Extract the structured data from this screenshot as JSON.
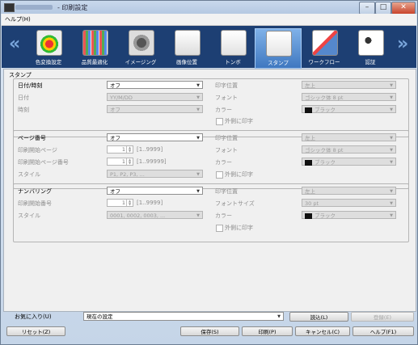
{
  "window": {
    "title": "- 印刷設定",
    "min": "–",
    "max": "□",
    "close": "✕"
  },
  "menu": {
    "help": "ヘルプ(H)"
  },
  "toolbar": {
    "prev": "«",
    "next": "»",
    "items": [
      {
        "label": "色変換設定",
        "icon": "color-conversion-icon"
      },
      {
        "label": "品質最適化",
        "icon": "quality-optimization-icon"
      },
      {
        "label": "イメージング",
        "icon": "imaging-icon"
      },
      {
        "label": "画像位置",
        "icon": "image-position-icon"
      },
      {
        "label": "トンボ",
        "icon": "crop-marks-icon"
      },
      {
        "label": "スタンプ",
        "icon": "stamp-icon"
      },
      {
        "label": "ワークフロー",
        "icon": "workflow-icon"
      },
      {
        "label": "認証",
        "icon": "authentication-icon"
      }
    ]
  },
  "section_title": "スタンプ",
  "datetime": {
    "label": "日付/時刻",
    "value": "オフ",
    "date_label": "日付",
    "date_value": "YY/M/DD",
    "time_label": "時刻",
    "time_value": "オフ",
    "pos_label": "印字位置",
    "pos_value": "左上",
    "font_label": "フォント",
    "font_value": "ゴシック体 8 pt",
    "color_label": "カラー",
    "color_value": "ブラック",
    "outside_label": "外側に印字"
  },
  "page_number": {
    "label": "ページ番号",
    "value": "オフ",
    "start_page_label": "印刷開始ページ",
    "start_page_value": "1",
    "start_page_range": "[1..9999]",
    "start_no_label": "印刷開始ページ番号",
    "start_no_value": "1",
    "start_no_range": "[1..99999]",
    "style_label": "スタイル",
    "style_value": "P1, P2, P3, ...",
    "pos_label": "印字位置",
    "pos_value": "左上",
    "font_label": "フォント",
    "font_value": "ゴシック体 8 pt",
    "color_label": "カラー",
    "color_value": "ブラック",
    "outside_label": "外側に印字"
  },
  "numbering": {
    "label": "ナンバリング",
    "value": "オフ",
    "start_no_label": "印刷開始番号",
    "start_no_value": "1",
    "start_no_range": "[1..9999]",
    "style_label": "スタイル",
    "style_value": "0001, 0002, 0003, ...",
    "pos_label": "印字位置",
    "pos_value": "左上",
    "font_size_label": "フォントサイズ",
    "font_size_value": "30 pt",
    "color_label": "カラー",
    "color_value": "ブラック",
    "outside_label": "外側に印字"
  },
  "favorites": {
    "label": "お気に入り(U)",
    "value": "現在の設定",
    "load": "読込(L)",
    "register": "登録(E)"
  },
  "buttons": {
    "reset": "リセット(Z)",
    "save": "保存(S)",
    "print": "印刷(P)",
    "cancel": "キャンセル(C)",
    "help": "ヘルプ(F1)"
  },
  "colors": {
    "toolbar_bg": "#1d3f73",
    "selected_tool": "#3f78c0"
  }
}
